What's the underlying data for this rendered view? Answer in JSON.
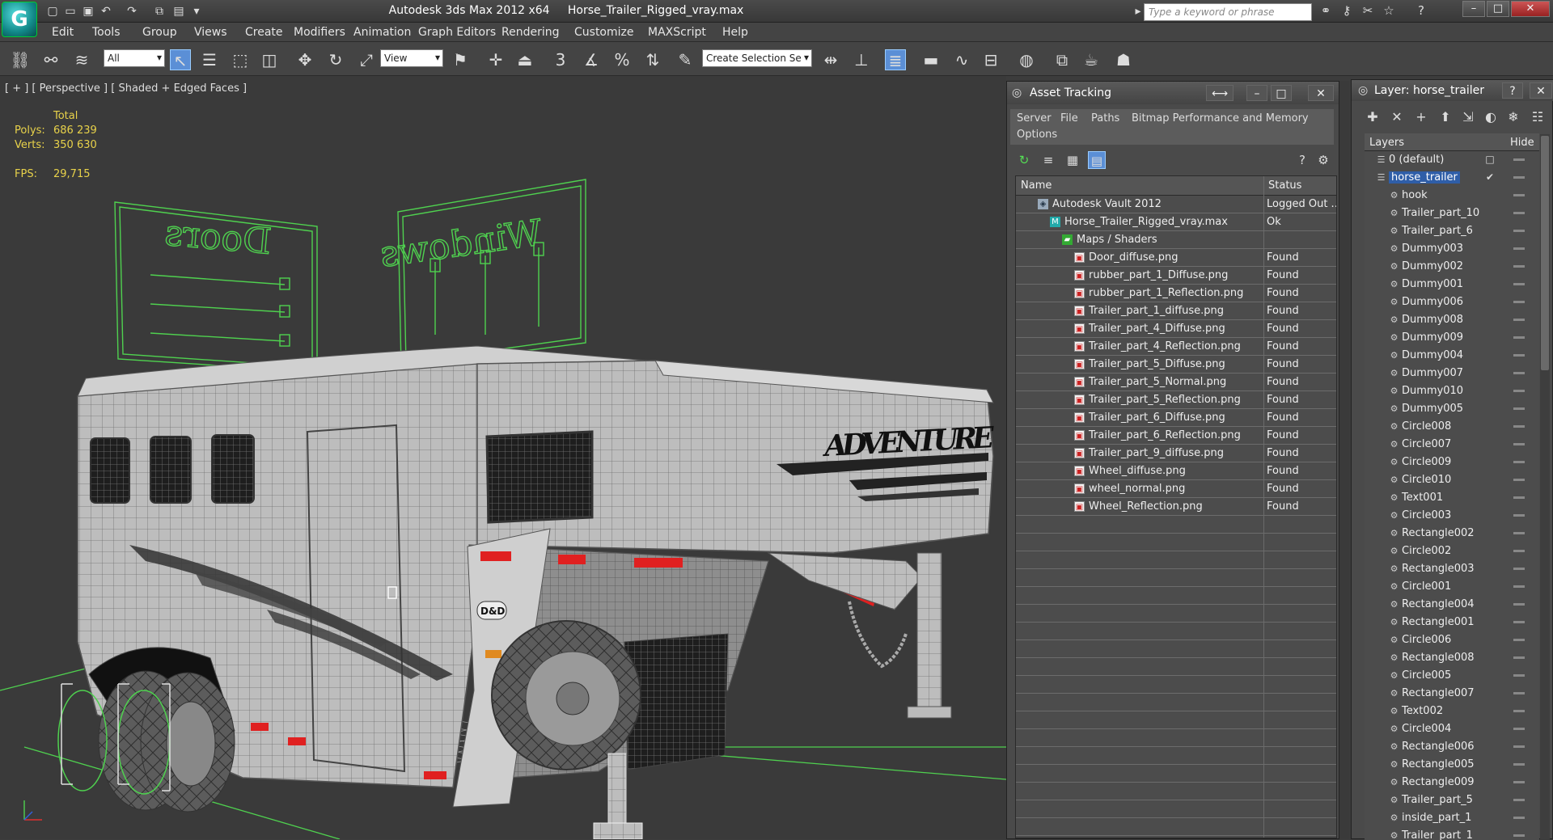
{
  "app": {
    "title": "Autodesk 3ds Max  2012 x64",
    "file": "Horse_Trailer_Rigged_vray.max",
    "logo_letter": "G",
    "search_placeholder": "Type a keyword or phrase"
  },
  "menu": [
    "Edit",
    "Tools",
    "Group",
    "Views",
    "Create",
    "Modifiers",
    "Animation",
    "Graph Editors",
    "Rendering",
    "Customize",
    "MAXScript",
    "Help"
  ],
  "toolbar": {
    "filter_value": "All",
    "coord_value": "View",
    "selection_set_value": "Create Selection Se",
    "snap_label": "3",
    "percent_label": "%"
  },
  "viewport": {
    "label": "[ + ] [ Perspective ] [ Shaded + Edged Faces ]",
    "stats": {
      "header": "Total",
      "polys_label": "Polys:",
      "polys_value": "686 239",
      "verts_label": "Verts:",
      "verts_value": "350 630",
      "fps_label": "FPS:",
      "fps_value": "29,715"
    },
    "control_labels": {
      "doors": "Doors",
      "windows": "Windows"
    },
    "trailer_brand": "ADVENTURE",
    "badge": "D&D"
  },
  "asset_tracking": {
    "title": "Asset Tracking",
    "menu": [
      "Server",
      "File",
      "Paths",
      "Bitmap Performance and Memory",
      "Options"
    ],
    "columns": {
      "name": "Name",
      "status": "Status"
    },
    "rows": [
      {
        "name": "Autodesk Vault 2012",
        "status": "Logged Out ...",
        "level": 1,
        "icon": "vault"
      },
      {
        "name": "Horse_Trailer_Rigged_vray.max",
        "status": "Ok",
        "level": 2,
        "icon": "max"
      },
      {
        "name": "Maps / Shaders",
        "status": "",
        "level": 3,
        "icon": "maps"
      },
      {
        "name": "Door_diffuse.png",
        "status": "Found",
        "level": 4,
        "icon": "file"
      },
      {
        "name": "rubber_part_1_Diffuse.png",
        "status": "Found",
        "level": 4,
        "icon": "file"
      },
      {
        "name": "rubber_part_1_Reflection.png",
        "status": "Found",
        "level": 4,
        "icon": "file"
      },
      {
        "name": "Trailer_part_1_diffuse.png",
        "status": "Found",
        "level": 4,
        "icon": "file"
      },
      {
        "name": "Trailer_part_4_Diffuse.png",
        "status": "Found",
        "level": 4,
        "icon": "file"
      },
      {
        "name": "Trailer_part_4_Reflection.png",
        "status": "Found",
        "level": 4,
        "icon": "file"
      },
      {
        "name": "Trailer_part_5_Diffuse.png",
        "status": "Found",
        "level": 4,
        "icon": "file"
      },
      {
        "name": "Trailer_part_5_Normal.png",
        "status": "Found",
        "level": 4,
        "icon": "file"
      },
      {
        "name": "Trailer_part_5_Reflection.png",
        "status": "Found",
        "level": 4,
        "icon": "file"
      },
      {
        "name": "Trailer_part_6_Diffuse.png",
        "status": "Found",
        "level": 4,
        "icon": "file"
      },
      {
        "name": "Trailer_part_6_Reflection.png",
        "status": "Found",
        "level": 4,
        "icon": "file"
      },
      {
        "name": "Trailer_part_9_diffuse.png",
        "status": "Found",
        "level": 4,
        "icon": "file"
      },
      {
        "name": "Wheel_diffuse.png",
        "status": "Found",
        "level": 4,
        "icon": "file"
      },
      {
        "name": "wheel_normal.png",
        "status": "Found",
        "level": 4,
        "icon": "file"
      },
      {
        "name": "Wheel_Reflection.png",
        "status": "Found",
        "level": 4,
        "icon": "file"
      }
    ]
  },
  "layer_panel": {
    "title": "Layer: horse_trailer",
    "columns": {
      "layers": "Layers",
      "hide": "Hide"
    },
    "layers": [
      {
        "name": "0 (default)",
        "level": 0,
        "type": "layer"
      },
      {
        "name": "horse_trailer",
        "level": 0,
        "type": "layer",
        "selected": true,
        "current": true
      },
      {
        "name": "hook",
        "level": 1,
        "type": "object"
      },
      {
        "name": "Trailer_part_10",
        "level": 1,
        "type": "object"
      },
      {
        "name": "Trailer_part_6",
        "level": 1,
        "type": "object"
      },
      {
        "name": "Dummy003",
        "level": 1,
        "type": "object"
      },
      {
        "name": "Dummy002",
        "level": 1,
        "type": "object"
      },
      {
        "name": "Dummy001",
        "level": 1,
        "type": "object"
      },
      {
        "name": "Dummy006",
        "level": 1,
        "type": "object"
      },
      {
        "name": "Dummy008",
        "level": 1,
        "type": "object"
      },
      {
        "name": "Dummy009",
        "level": 1,
        "type": "object"
      },
      {
        "name": "Dummy004",
        "level": 1,
        "type": "object"
      },
      {
        "name": "Dummy007",
        "level": 1,
        "type": "object"
      },
      {
        "name": "Dummy010",
        "level": 1,
        "type": "object"
      },
      {
        "name": "Dummy005",
        "level": 1,
        "type": "object"
      },
      {
        "name": "Circle008",
        "level": 1,
        "type": "object"
      },
      {
        "name": "Circle007",
        "level": 1,
        "type": "object"
      },
      {
        "name": "Circle009",
        "level": 1,
        "type": "object"
      },
      {
        "name": "Circle010",
        "level": 1,
        "type": "object"
      },
      {
        "name": "Text001",
        "level": 1,
        "type": "object"
      },
      {
        "name": "Circle003",
        "level": 1,
        "type": "object"
      },
      {
        "name": "Rectangle002",
        "level": 1,
        "type": "object"
      },
      {
        "name": "Circle002",
        "level": 1,
        "type": "object"
      },
      {
        "name": "Rectangle003",
        "level": 1,
        "type": "object"
      },
      {
        "name": "Circle001",
        "level": 1,
        "type": "object"
      },
      {
        "name": "Rectangle004",
        "level": 1,
        "type": "object"
      },
      {
        "name": "Rectangle001",
        "level": 1,
        "type": "object"
      },
      {
        "name": "Circle006",
        "level": 1,
        "type": "object"
      },
      {
        "name": "Rectangle008",
        "level": 1,
        "type": "object"
      },
      {
        "name": "Circle005",
        "level": 1,
        "type": "object"
      },
      {
        "name": "Rectangle007",
        "level": 1,
        "type": "object"
      },
      {
        "name": "Text002",
        "level": 1,
        "type": "object"
      },
      {
        "name": "Circle004",
        "level": 1,
        "type": "object"
      },
      {
        "name": "Rectangle006",
        "level": 1,
        "type": "object"
      },
      {
        "name": "Rectangle005",
        "level": 1,
        "type": "object"
      },
      {
        "name": "Rectangle009",
        "level": 1,
        "type": "object"
      },
      {
        "name": "Trailer_part_5",
        "level": 1,
        "type": "object"
      },
      {
        "name": "inside_part_1",
        "level": 1,
        "type": "object"
      },
      {
        "name": "Trailer_part_1",
        "level": 1,
        "type": "object"
      }
    ]
  },
  "colors": {
    "selection_blue": "#2f5ea8",
    "stat_yellow": "#e8d24a",
    "wire_green": "#4fd14f",
    "marker_red": "#e02020"
  }
}
